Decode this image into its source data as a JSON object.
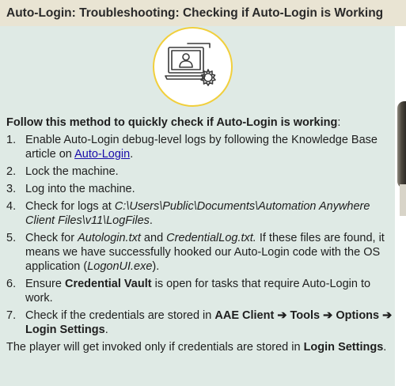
{
  "header": {
    "title": "Auto-Login: Troubleshooting: Checking if Auto-Login is Working"
  },
  "icon": {
    "name": "computer-user-settings-icon",
    "ring_color": "#f1cf3c"
  },
  "content": {
    "intro_bold": "Follow this method to quickly check if Auto-Login is working",
    "intro_tail": ":",
    "steps": [
      {
        "num": "1.",
        "text_before": "Enable Auto-Login debug-level logs by following the Knowledge Base article on ",
        "link": "Auto-Login",
        "text_after": "."
      },
      {
        "num": "2.",
        "text": "Lock the machine."
      },
      {
        "num": "3.",
        "text": "Log into the machine."
      },
      {
        "num": "4.",
        "text_before": "Check for logs at ",
        "path": "C:\\Users\\Public\\Documents\\Automation Anywhere Client Files\\v11\\LogFiles",
        "text_after": "."
      },
      {
        "num": "5.",
        "pre": "Check for ",
        "file1": "Autologin.txt",
        "mid": " and ",
        "file2": "CredentialLog.txt.",
        "rest": " If these files are found, it means we have successfully hooked our Auto-Login code with the OS application (",
        "exe": "LogonUI.exe",
        "end": ")."
      },
      {
        "num": "6.",
        "pre": "Ensure ",
        "bold": "Credential Vault",
        "post": " is open for tasks that require Auto-Login to work."
      },
      {
        "num": "7.",
        "pre": "Check if the credentials are stored in ",
        "nav1": "AAE Client",
        "arrow1": " ➔ ",
        "nav2": "Tools",
        "arrow2": " ➔ ",
        "nav3": "Options",
        "arrow3": " ➔ ",
        "nav4": "Login Settings",
        "end": "."
      }
    ],
    "footer_pre": "The player will get invoked only if credentials are stored in ",
    "footer_bold": "Login Settings",
    "footer_end": "."
  },
  "colors": {
    "page_background": "#dfeae5",
    "title_background": "#e9e4d3",
    "link": "#1a0dab"
  }
}
